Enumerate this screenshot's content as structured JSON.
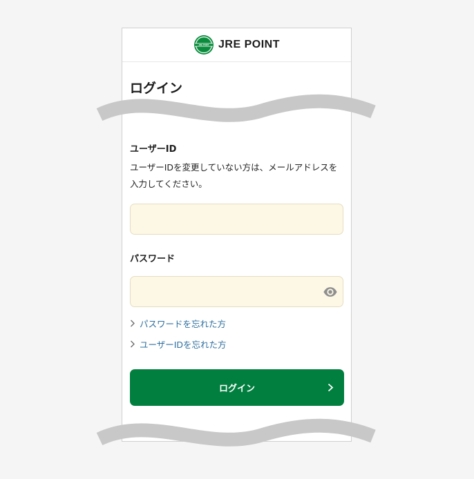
{
  "header": {
    "logo_text": "JRE POINT",
    "logo_mark_text": "JRE POINT",
    "colors": {
      "green": "#0a8c3c"
    }
  },
  "page": {
    "title": "ログイン"
  },
  "user_id": {
    "label": "ユーザーID",
    "help": "ユーザーIDを変更していない方は、メールアドレスを入力してください。",
    "value": "",
    "placeholder": ""
  },
  "password": {
    "label": "パスワード",
    "value": "",
    "placeholder": "",
    "toggle_icon": "eye-icon"
  },
  "links": {
    "forgot_password": "パスワードを忘れた方",
    "forgot_user_id": "ユーザーIDを忘れた方"
  },
  "login_button": {
    "label": "ログイン",
    "color": "#017f3f"
  },
  "colors": {
    "input_bg": "#fdf8e6",
    "link": "#2f6f9f"
  }
}
